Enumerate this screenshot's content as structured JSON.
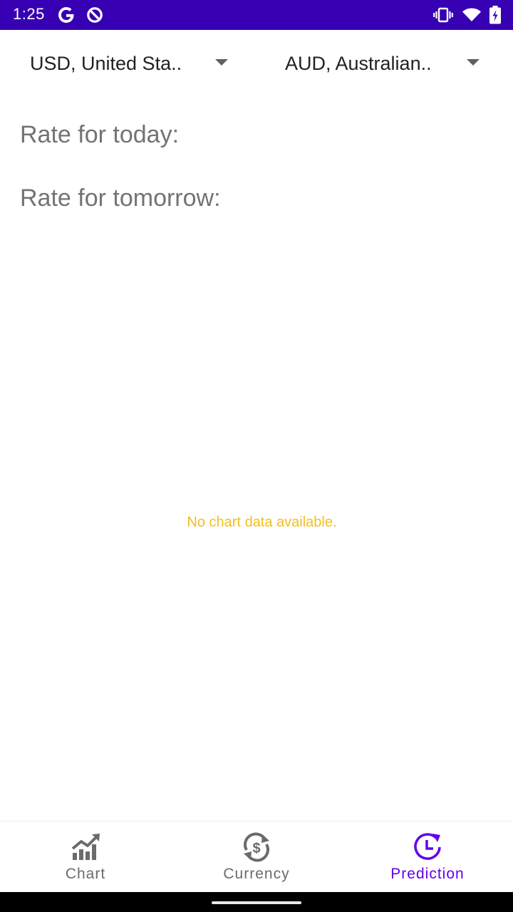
{
  "status_bar": {
    "time": "1:25",
    "background_color": "#3700B3",
    "left_icons": [
      "google-icon",
      "data-saver-icon"
    ],
    "right_icons": [
      "vibrate-icon",
      "wifi-icon",
      "battery-icon"
    ]
  },
  "currency_selectors": {
    "from": {
      "value": "USD, United Sta.."
    },
    "to": {
      "value": "AUD, Australian.."
    }
  },
  "rates": {
    "today_label": "Rate for today:",
    "tomorrow_label": "Rate for tomorrow:"
  },
  "chart": {
    "empty_message": "No chart data available.",
    "empty_message_color": "#F2BE22"
  },
  "bottom_nav": {
    "active_color": "#6200EE",
    "items": [
      {
        "label": "Chart",
        "icon": "chart-trend-icon",
        "active": false
      },
      {
        "label": "Currency",
        "icon": "currency-exchange-icon",
        "active": false
      },
      {
        "label": "Prediction",
        "icon": "prediction-clock-icon",
        "active": true
      }
    ]
  }
}
